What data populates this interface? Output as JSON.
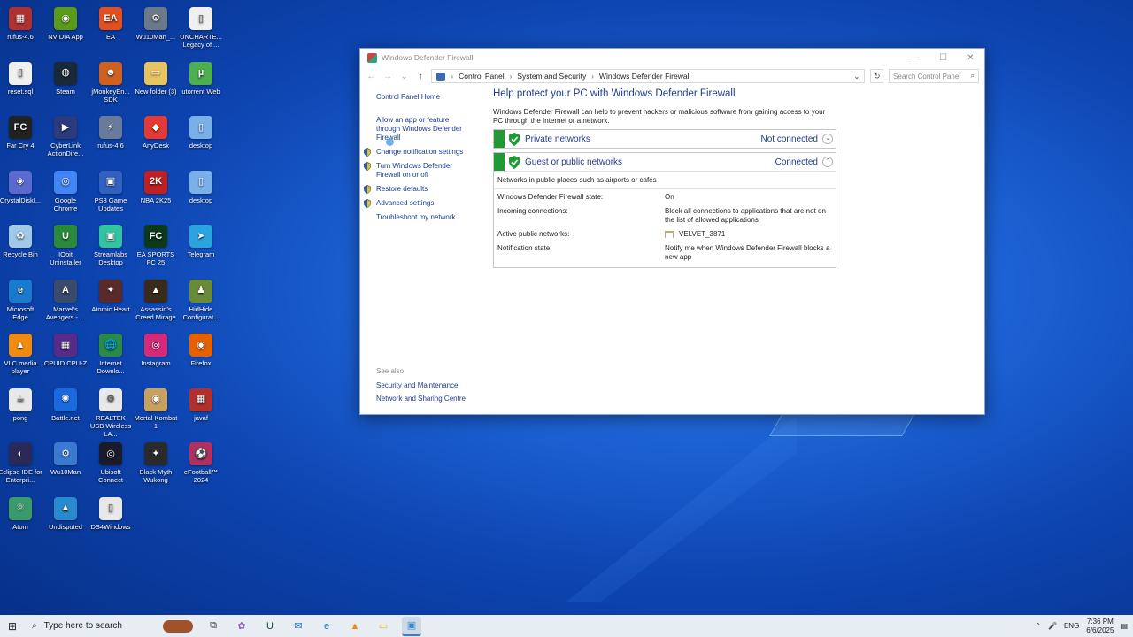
{
  "desktop": {
    "icons": [
      {
        "label": "rufus-4.6",
        "color": "#b03030",
        "glyph": "▦"
      },
      {
        "label": "NVIDIA App",
        "color": "#5a9b1a",
        "glyph": "◉"
      },
      {
        "label": "EA",
        "color": "#e05020",
        "glyph": "EA"
      },
      {
        "label": "Wu10Man_...",
        "color": "#6a7a8a",
        "glyph": "⚙"
      },
      {
        "label": "UNCHARTE... Legacy of ...",
        "color": "#f0f0f0",
        "glyph": "▯"
      },
      {
        "label": "reset.sql",
        "color": "#f0f0f0",
        "glyph": "▯"
      },
      {
        "label": "Steam",
        "color": "#1b2838",
        "glyph": "◍"
      },
      {
        "label": "jMonkeyEn... SDK",
        "color": "#d06020",
        "glyph": "☻"
      },
      {
        "label": "New folder (3)",
        "color": "#e8c460",
        "glyph": "▭"
      },
      {
        "label": "utorrent Web",
        "color": "#4caf50",
        "glyph": "µ"
      },
      {
        "label": "Far Cry 4",
        "color": "#222222",
        "glyph": "FC"
      },
      {
        "label": "CyberLink ActionDire...",
        "color": "#2a3a7a",
        "glyph": "▶"
      },
      {
        "label": "rufus-4.6",
        "color": "#6a7a9a",
        "glyph": "⚡"
      },
      {
        "label": "AnyDesk",
        "color": "#e53935",
        "glyph": "◆"
      },
      {
        "label": "desktop",
        "color": "#7ab0e8",
        "glyph": "▯"
      },
      {
        "label": "CrystalDiskI...",
        "color": "#5a6acf",
        "glyph": "◈"
      },
      {
        "label": "Google Chrome",
        "color": "#4285f4",
        "glyph": "◎"
      },
      {
        "label": "PS3 Game Updates",
        "color": "#3060c0",
        "glyph": "▣"
      },
      {
        "label": "NBA 2K25",
        "color": "#c02020",
        "glyph": "2K"
      },
      {
        "label": "desktop",
        "color": "#7ab0e8",
        "glyph": "▯"
      },
      {
        "label": "Recycle Bin",
        "color": "#a0c8e8",
        "glyph": "♻"
      },
      {
        "label": "IObit Uninstaller",
        "color": "#2a8a3a",
        "glyph": "U"
      },
      {
        "label": "Streamlabs Desktop",
        "color": "#31c3a2",
        "glyph": "▣"
      },
      {
        "label": "EA SPORTS FC 25",
        "color": "#0a3a1a",
        "glyph": "FC"
      },
      {
        "label": "Telegram",
        "color": "#2aa3df",
        "glyph": "➤"
      },
      {
        "label": "Microsoft Edge",
        "color": "#1a7ad0",
        "glyph": "e"
      },
      {
        "label": "Marvel's Avengers - ...",
        "color": "#3a4a6a",
        "glyph": "A"
      },
      {
        "label": "Atomic Heart",
        "color": "#5a2a2a",
        "glyph": "✦"
      },
      {
        "label": "Assassin's Creed Mirage",
        "color": "#3a2a1a",
        "glyph": "▲"
      },
      {
        "label": "HidHide Configurat...",
        "color": "#6a8a3a",
        "glyph": "♟"
      },
      {
        "label": "VLC media player",
        "color": "#f08a10",
        "glyph": "▲"
      },
      {
        "label": "CPUID CPU-Z",
        "color": "#5a2a8a",
        "glyph": "▦"
      },
      {
        "label": "Internet Downlo...",
        "color": "#2a8a4a",
        "glyph": "🌐"
      },
      {
        "label": "Instagram",
        "color": "#d6297a",
        "glyph": "◎"
      },
      {
        "label": "Firefox",
        "color": "#e66000",
        "glyph": "◉"
      },
      {
        "label": "pong",
        "color": "#e8e8e8",
        "glyph": "☕"
      },
      {
        "label": "Battle.net",
        "color": "#1a6adf",
        "glyph": "✺"
      },
      {
        "label": "REALTEK USB Wireless LA...",
        "color": "#e8e8e8",
        "glyph": "⚙"
      },
      {
        "label": "Mortal Kombat 1",
        "color": "#c8a060",
        "glyph": "◉"
      },
      {
        "label": "javaf",
        "color": "#b03030",
        "glyph": "▦"
      },
      {
        "label": "Eclipse IDE for Enterpri...",
        "color": "#2a2a5a",
        "glyph": "◐"
      },
      {
        "label": "Wu10Man",
        "color": "#3a7ad0",
        "glyph": "⚙"
      },
      {
        "label": "Ubisoft Connect",
        "color": "#1a1a2a",
        "glyph": "◎"
      },
      {
        "label": "Black Myth Wukong",
        "color": "#2a2a2a",
        "glyph": "✦"
      },
      {
        "label": "eFootball™ 2024",
        "color": "#b03060",
        "glyph": "⚽"
      },
      {
        "label": "Atom",
        "color": "#3a9a6a",
        "glyph": "⚛"
      },
      {
        "label": "Undisputed",
        "color": "#2a8ad0",
        "glyph": "▲"
      },
      {
        "label": "DS4Windows",
        "color": "#e8e8e8",
        "glyph": "▯"
      }
    ]
  },
  "window": {
    "title": "Windows Defender Firewall",
    "controls": {
      "minimize": "—",
      "maximize": "☐",
      "close": "✕"
    },
    "nav": {
      "back": "←",
      "forward": "→",
      "recent": "⌄",
      "up": "↑"
    },
    "breadcrumb": [
      "Control Panel",
      "System and Security",
      "Windows Defender Firewall"
    ],
    "breadcrumb_sep": "›",
    "dropdown": "⌄",
    "refresh": "↻",
    "search_placeholder": "Search Control Panel",
    "search_icon": "⌕"
  },
  "leftpane": {
    "home": "Control Panel Home",
    "allow_app": "Allow an app or feature through Windows Defender Firewall",
    "change_notif": "Change notification settings",
    "turn_on_off": "Turn Windows Defender Firewall on or off",
    "restore": "Restore defaults",
    "advanced": "Advanced settings",
    "troubleshoot": "Troubleshoot my network",
    "see_also": "See also",
    "security_maint": "Security and Maintenance",
    "network_sharing": "Network and Sharing Centre"
  },
  "main": {
    "heading": "Help protect your PC with Windows Defender Firewall",
    "intro": "Windows Defender Firewall can help to prevent hackers or malicious software from gaining access to your PC through the Internet or a network.",
    "private": {
      "name": "Private networks",
      "status": "Not connected",
      "chevron": "⌄"
    },
    "public": {
      "name": "Guest or public networks",
      "status": "Connected",
      "chevron": "⌃",
      "description": "Networks in public places such as airports or cafés",
      "rows": [
        {
          "key": "Windows Defender Firewall state:",
          "value": "On"
        },
        {
          "key": "Incoming connections:",
          "value": "Block all connections to applications that are not on the list of allowed applications"
        },
        {
          "key": "Active public networks:",
          "value": "VELVET_3871"
        },
        {
          "key": "Notification state:",
          "value": "Notify me when Windows Defender Firewall blocks a new app"
        }
      ]
    }
  },
  "taskbar": {
    "start": "⊞",
    "search_icon": "⌕",
    "search_placeholder": "Type here to search",
    "apps": [
      {
        "name": "task-view",
        "glyph": "⧉",
        "color": "#333333"
      },
      {
        "name": "copilot",
        "glyph": "✿",
        "color": "#8a5ad0"
      },
      {
        "name": "upwork",
        "glyph": "U",
        "color": "#1a4a3a"
      },
      {
        "name": "mail",
        "glyph": "✉",
        "color": "#1a6adf"
      },
      {
        "name": "edge",
        "glyph": "e",
        "color": "#1a7ad0"
      },
      {
        "name": "vlc",
        "glyph": "▲",
        "color": "#f08a10"
      },
      {
        "name": "file-explorer",
        "glyph": "▭",
        "color": "#e8b030"
      },
      {
        "name": "control-panel",
        "glyph": "▣",
        "color": "#3a8ad0"
      }
    ],
    "tray": {
      "chevron": "⌃",
      "mic": "🎤",
      "lang": "ENG",
      "time": "7:36 PM",
      "date": "6/6/2025",
      "notif": "▤"
    }
  }
}
